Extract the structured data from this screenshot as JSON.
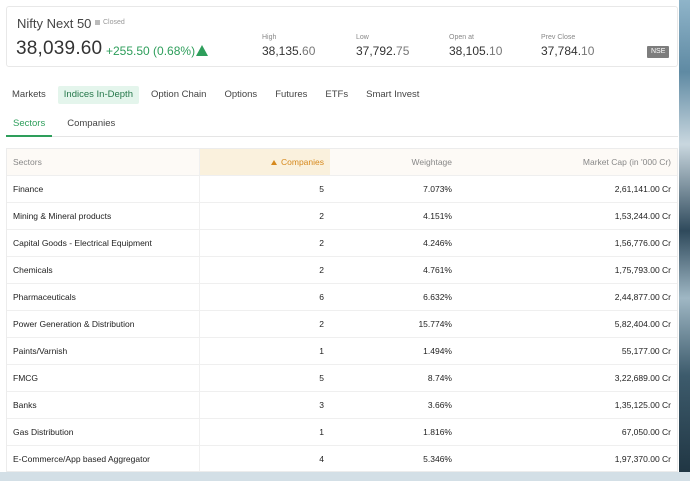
{
  "header": {
    "index_name": "Nifty Next 50",
    "status": "Closed",
    "price": "38,039.60",
    "change": "+255.50 (0.68%)",
    "change_color": "#2e9e5b",
    "stats": [
      {
        "label": "High",
        "int": "38,135.",
        "dec": "60"
      },
      {
        "label": "Low",
        "int": "37,792.",
        "dec": "75"
      },
      {
        "label": "Open at",
        "int": "38,105.",
        "dec": "10"
      },
      {
        "label": "Prev Close",
        "int": "37,784.",
        "dec": "10"
      }
    ],
    "exchange": "NSE"
  },
  "main_tabs": [
    "Markets",
    "Indices In-Depth",
    "Option Chain",
    "Options",
    "Futures",
    "ETFs",
    "Smart Invest"
  ],
  "sub_tabs": [
    "Sectors",
    "Companies"
  ],
  "table": {
    "headers": [
      "Sectors",
      "Companies",
      "Weightage",
      "Market Cap (in '000 Cr)"
    ],
    "rows": [
      {
        "sector": "Finance",
        "companies": "5",
        "weightage": "7.073%",
        "mcap": "2,61,141.00 Cr"
      },
      {
        "sector": "Mining & Mineral products",
        "companies": "2",
        "weightage": "4.151%",
        "mcap": "1,53,244.00 Cr"
      },
      {
        "sector": "Capital Goods - Electrical Equipment",
        "companies": "2",
        "weightage": "4.246%",
        "mcap": "1,56,776.00 Cr"
      },
      {
        "sector": "Chemicals",
        "companies": "2",
        "weightage": "4.761%",
        "mcap": "1,75,793.00 Cr"
      },
      {
        "sector": "Pharmaceuticals",
        "companies": "6",
        "weightage": "6.632%",
        "mcap": "2,44,877.00 Cr"
      },
      {
        "sector": "Power Generation & Distribution",
        "companies": "2",
        "weightage": "15.774%",
        "mcap": "5,82,404.00 Cr"
      },
      {
        "sector": "Paints/Varnish",
        "companies": "1",
        "weightage": "1.494%",
        "mcap": "55,177.00 Cr"
      },
      {
        "sector": "FMCG",
        "companies": "5",
        "weightage": "8.74%",
        "mcap": "3,22,689.00 Cr"
      },
      {
        "sector": "Banks",
        "companies": "3",
        "weightage": "3.66%",
        "mcap": "1,35,125.00 Cr"
      },
      {
        "sector": "Gas Distribution",
        "companies": "1",
        "weightage": "1.816%",
        "mcap": "67,050.00 Cr"
      },
      {
        "sector": "E-Commerce/App based Aggregator",
        "companies": "4",
        "weightage": "5.346%",
        "mcap": "1,97,370.00 Cr"
      }
    ]
  },
  "icons": {
    "sort": "sort-ascending-icon",
    "trend": "up-arrow-icon"
  }
}
